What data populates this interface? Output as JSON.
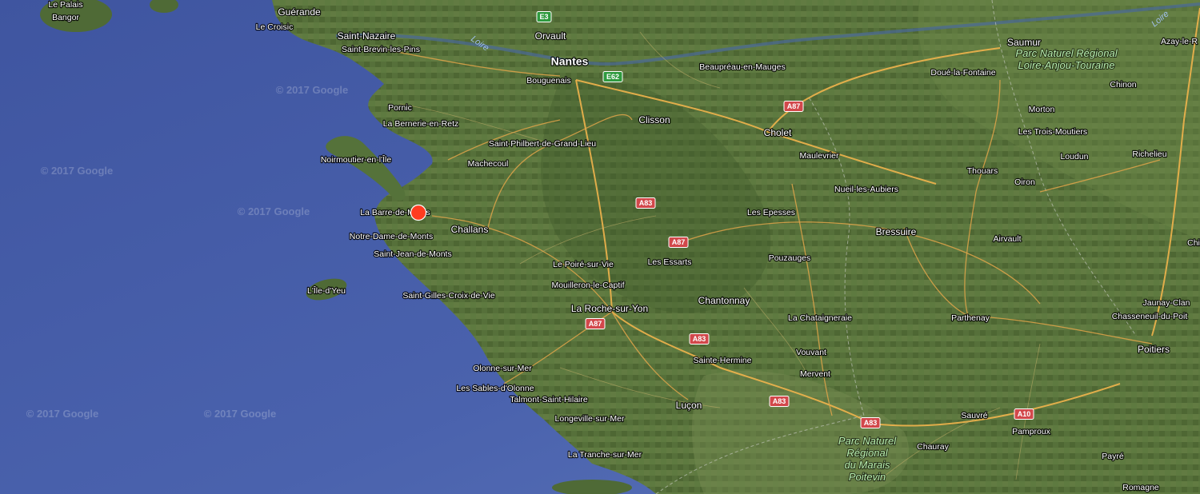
{
  "map": {
    "type": "satellite",
    "watermarks": [
      "© 2017 Google",
      "© 2017 Google",
      "© 2017 Google",
      "© 2017 Google",
      "© 2017 Google"
    ],
    "marker": {
      "color": "#ff3b1f"
    },
    "places": [
      {
        "name": "Le Palais",
        "size": "sm"
      },
      {
        "name": "Bangor",
        "size": "sm"
      },
      {
        "name": "Guérande",
        "size": "mid"
      },
      {
        "name": "Le Croisic",
        "size": "sm"
      },
      {
        "name": "Saint-Nazaire",
        "size": "mid"
      },
      {
        "name": "Saint-Brevin-les-Pins",
        "size": "sm"
      },
      {
        "name": "Orvault",
        "size": "mid"
      },
      {
        "name": "Nantes",
        "size": "big"
      },
      {
        "name": "Bouguenais",
        "size": "sm"
      },
      {
        "name": "Beaupréau-en-Mauges",
        "size": "sm"
      },
      {
        "name": "Saumur",
        "size": "mid"
      },
      {
        "name": "Azay-le-R",
        "size": "sm"
      },
      {
        "name": "Doué-la-Fontaine",
        "size": "sm"
      },
      {
        "name": "Chinon",
        "size": "sm"
      },
      {
        "name": "Pornic",
        "size": "sm"
      },
      {
        "name": "La Bernerie-en-Retz",
        "size": "sm"
      },
      {
        "name": "Clisson",
        "size": "mid"
      },
      {
        "name": "Cholet",
        "size": "mid"
      },
      {
        "name": "Morton",
        "size": "sm"
      },
      {
        "name": "Les Trois-Moutiers",
        "size": "sm"
      },
      {
        "name": "Saint-Philbert-de-Grand-Lieu",
        "size": "sm"
      },
      {
        "name": "Maulevrier",
        "size": "sm"
      },
      {
        "name": "Loudun",
        "size": "sm"
      },
      {
        "name": "Richelieu",
        "size": "sm"
      },
      {
        "name": "Noirmoutier-en-l'Île",
        "size": "sm"
      },
      {
        "name": "Machecoul",
        "size": "sm"
      },
      {
        "name": "Thouars",
        "size": "sm"
      },
      {
        "name": "Oiron",
        "size": "sm"
      },
      {
        "name": "Nueil-les-Aubiers",
        "size": "sm"
      },
      {
        "name": "La Barre-de-Monts",
        "size": "sm"
      },
      {
        "name": "Les Epesses",
        "size": "sm"
      },
      {
        "name": "Challans",
        "size": "mid"
      },
      {
        "name": "Bressuire",
        "size": "mid"
      },
      {
        "name": "Notre-Dame-de-Monts",
        "size": "sm"
      },
      {
        "name": "Airvault",
        "size": "sm"
      },
      {
        "name": "Saint-Jean-de-Monts",
        "size": "sm"
      },
      {
        "name": "Les Essarts",
        "size": "sm"
      },
      {
        "name": "Pouzauges",
        "size": "sm"
      },
      {
        "name": "Le Poiré-sur-Vie",
        "size": "sm"
      },
      {
        "name": "L'Île-d'Yeu",
        "size": "sm"
      },
      {
        "name": "Mouilleron-le-Captif",
        "size": "sm"
      },
      {
        "name": "Saint-Gilles-Croix-de-Vie",
        "size": "sm"
      },
      {
        "name": "Chantonnay",
        "size": "mid"
      },
      {
        "name": "Jaunay-Clan",
        "size": "sm"
      },
      {
        "name": "La Roche-sur-Yon",
        "size": "mid"
      },
      {
        "name": "La Chataigneraie",
        "size": "sm"
      },
      {
        "name": "Parthenay",
        "size": "sm"
      },
      {
        "name": "Chasseneuil-du-Poit",
        "size": "sm"
      },
      {
        "name": "Poitiers",
        "size": "mid"
      },
      {
        "name": "Vouvant",
        "size": "sm"
      },
      {
        "name": "Sainte-Hermine",
        "size": "sm"
      },
      {
        "name": "Olonne-sur-Mer",
        "size": "sm"
      },
      {
        "name": "Mervent",
        "size": "sm"
      },
      {
        "name": "Les Sables-d'Olonne",
        "size": "sm"
      },
      {
        "name": "Talmont-Saint-Hilaire",
        "size": "sm"
      },
      {
        "name": "Luçon",
        "size": "mid"
      },
      {
        "name": "Longeville-sur-Mer",
        "size": "sm"
      },
      {
        "name": "Sauvré",
        "size": "sm"
      },
      {
        "name": "Pamproux",
        "size": "sm"
      },
      {
        "name": "Chauray",
        "size": "sm"
      },
      {
        "name": "La Tranche-sur-Mer",
        "size": "sm"
      },
      {
        "name": "Payré",
        "size": "sm"
      },
      {
        "name": "Romagne",
        "size": "sm"
      },
      {
        "name": "Chi",
        "size": "sm"
      }
    ],
    "parks": [
      {
        "lines": [
          "Parc Naturel Régional",
          "Loire-Anjou-Touraine"
        ]
      },
      {
        "lines": [
          "Parc Naturel",
          "Régional",
          "du Marais",
          "Poitevin"
        ]
      }
    ],
    "rivers": [
      "Loire",
      "Loire"
    ],
    "road_shields": [
      {
        "label": "E3",
        "color": "green"
      },
      {
        "label": "E62",
        "color": "green"
      },
      {
        "label": "A87",
        "color": "red"
      },
      {
        "label": "A83",
        "color": "red"
      },
      {
        "label": "A87",
        "color": "red"
      },
      {
        "label": "A87",
        "color": "red"
      },
      {
        "label": "A83",
        "color": "red"
      },
      {
        "label": "A83",
        "color": "red"
      },
      {
        "label": "A83",
        "color": "red"
      },
      {
        "label": "A10",
        "color": "red"
      }
    ]
  }
}
